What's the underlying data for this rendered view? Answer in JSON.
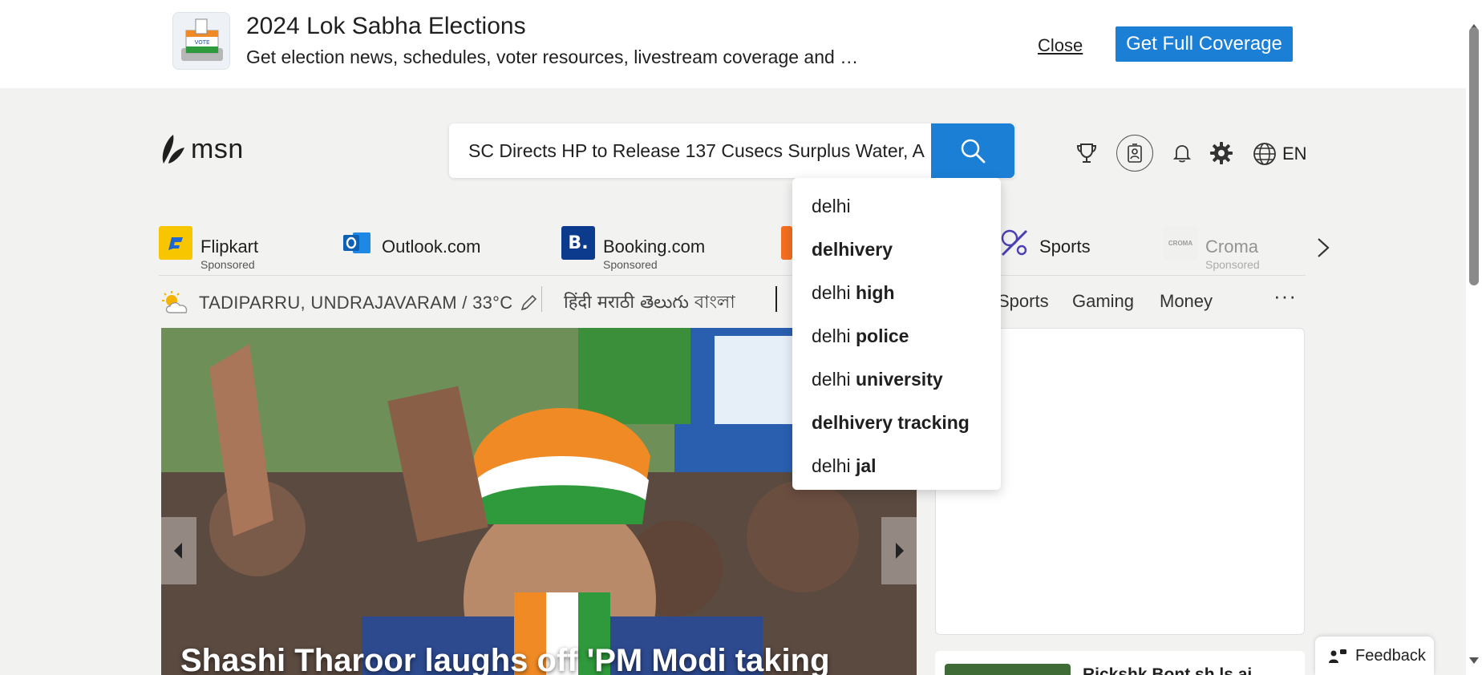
{
  "banner": {
    "title": "2024 Lok Sabha Elections",
    "subtitle": "Get election news, schedules, voter resources, livestream coverage and …",
    "close_label": "Close",
    "cta_label": "Get Full Coverage",
    "logo_caption": "VOTE"
  },
  "header": {
    "logo_text": "msn",
    "search_value": "SC Directs HP to Release 137 Cusecs Surplus Water, A",
    "language": "EN"
  },
  "suggestions": [
    {
      "prefix": "delhi",
      "suffix": ""
    },
    {
      "prefix": "",
      "suffix": "delhivery"
    },
    {
      "prefix": "delhi ",
      "suffix": "high"
    },
    {
      "prefix": "delhi ",
      "suffix": "police"
    },
    {
      "prefix": "delhi ",
      "suffix": "university"
    },
    {
      "prefix": "",
      "suffix": "delhivery tracking"
    },
    {
      "prefix": "delhi ",
      "suffix": "jal"
    }
  ],
  "quicklinks": [
    {
      "name": "Flipkart",
      "sponsored": "Sponsored"
    },
    {
      "name": "Outlook.com",
      "sponsored": ""
    },
    {
      "name": "Booking.com",
      "sponsored": "Sponsored"
    },
    {
      "name": "Sports",
      "sponsored": ""
    },
    {
      "name": "Croma",
      "sponsored": "Sponsored"
    }
  ],
  "quicklink_icons": {
    "booking": "B.",
    "croma": "CROMA"
  },
  "weather": {
    "location": "TADIPARRU, UNDRAJAVARAM / 33°C"
  },
  "languages": "हिंदी  मराठी  తెలుగు  বাংলা",
  "nav": [
    "Sports",
    "Gaming",
    "Money"
  ],
  "more_label": "···",
  "hero": {
    "title": "Shashi Tharoor laughs off 'PM Modi taking"
  },
  "news_card": {
    "title": "Rickshk Bont sh  ls ai"
  },
  "feedback_label": "Feedback",
  "colors": {
    "accent": "#1b7fd6",
    "page_bg": "#f2f2f1"
  }
}
